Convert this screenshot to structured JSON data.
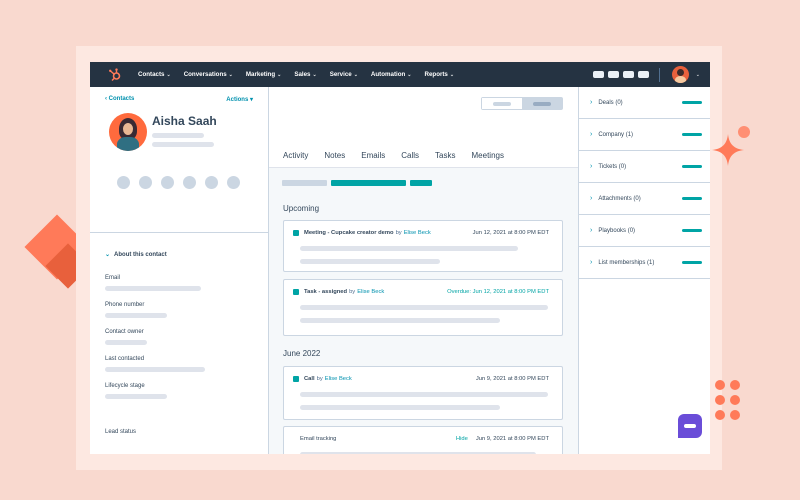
{
  "nav": {
    "items": [
      {
        "label": "Contacts"
      },
      {
        "label": "Conversations"
      },
      {
        "label": "Marketing"
      },
      {
        "label": "Sales"
      },
      {
        "label": "Service"
      },
      {
        "label": "Automation"
      },
      {
        "label": "Reports"
      }
    ]
  },
  "contact": {
    "back_label": "Contacts",
    "actions_label": "Actions",
    "name": "Aisha Saah",
    "about_label": "About this contact",
    "properties": [
      {
        "label": "Email"
      },
      {
        "label": "Phone number"
      },
      {
        "label": "Contact owner"
      },
      {
        "label": "Last contacted"
      },
      {
        "label": "Lifecycle stage"
      }
    ],
    "lead_status_label": "Lead status"
  },
  "tabs": [
    {
      "label": "Activity"
    },
    {
      "label": "Notes"
    },
    {
      "label": "Emails"
    },
    {
      "label": "Calls"
    },
    {
      "label": "Tasks"
    },
    {
      "label": "Meetings"
    }
  ],
  "timeline": {
    "upcoming_heading": "Upcoming",
    "june_heading": "June 2022",
    "cards": [
      {
        "title": "Meeting - Cupcake creator demo",
        "by": "by",
        "person": "Elise Beck",
        "date": "Jun 12, 2021 at 8:00 PM EDT"
      },
      {
        "title": "Task - assigned",
        "by": "by",
        "person": "Elise Beck",
        "date": "Jun 12, 2021 at 8:00 PM EDT",
        "overdue": "Overdue:"
      },
      {
        "title": "Call",
        "by": "by",
        "person": "Elise Beck",
        "date": "Jun 9, 2021 at 8:00 PM EDT"
      },
      {
        "title": "Email tracking",
        "hide": "Hide",
        "date": "Jun 9, 2021 at 8:00 PM EDT"
      }
    ]
  },
  "right_sidebar": {
    "items": [
      {
        "label": "Deals (0)"
      },
      {
        "label": "Company (1)"
      },
      {
        "label": "Tickets (0)"
      },
      {
        "label": "Attachments (0)"
      },
      {
        "label": "Playbooks (0)"
      },
      {
        "label": "List memberships (1)"
      }
    ]
  },
  "colors": {
    "background": "#f9d9cf",
    "nav_bg": "#253342",
    "accent_teal": "#00a4a5",
    "link_blue": "#0091ae",
    "brand_orange": "#ff7a59"
  }
}
